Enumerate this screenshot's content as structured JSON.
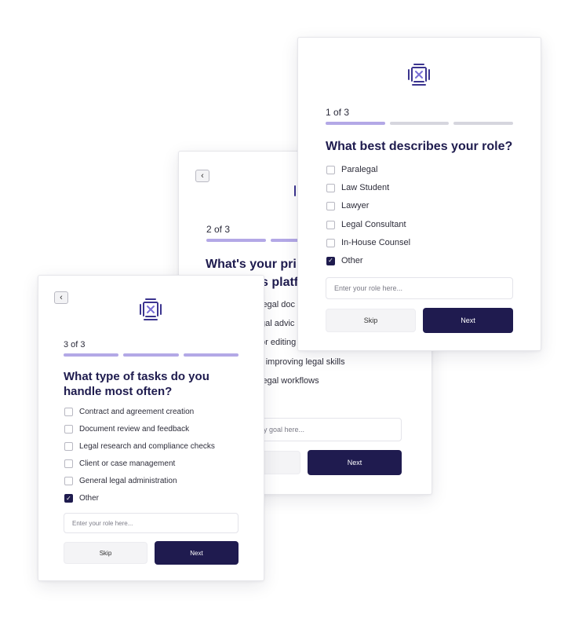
{
  "card_middle": {
    "step": "2 of 3",
    "title_line1": "What's your pri",
    "title_line2": "s platf",
    "options": [
      "legal doc",
      "gal advic",
      "or editing",
      "r improving legal skills",
      "legal workflows"
    ],
    "input_placeholder": "nary goal here...",
    "next_label": "Next"
  },
  "card_right": {
    "step": "1 of 3",
    "title": "What best describes your role?",
    "options": [
      {
        "label": "Paralegal",
        "checked": false
      },
      {
        "label": "Law Student",
        "checked": false
      },
      {
        "label": "Lawyer",
        "checked": false
      },
      {
        "label": "Legal Consultant",
        "checked": false
      },
      {
        "label": "In-House Counsel",
        "checked": false
      },
      {
        "label": "Other",
        "checked": true
      }
    ],
    "input_placeholder": "Enter your role here...",
    "skip_label": "Skip",
    "next_label": "Next"
  },
  "card_left": {
    "step": "3 of 3",
    "title_line1": "What type of tasks do you",
    "title_line2": "handle most often?",
    "options": [
      {
        "label": "Contract and agreement creation",
        "checked": false
      },
      {
        "label": "Document review and feedback",
        "checked": false
      },
      {
        "label": "Legal research and compliance checks",
        "checked": false
      },
      {
        "label": "Client or case management",
        "checked": false
      },
      {
        "label": "General legal administration",
        "checked": false
      },
      {
        "label": "Other",
        "checked": true
      }
    ],
    "input_placeholder": "Enter your role here...",
    "skip_label": "Skip",
    "next_label": "Next"
  },
  "icons": {
    "back": "chevron-left-icon",
    "logo": "brand-logo-icon",
    "check": "checkmark-icon"
  },
  "colors": {
    "primary": "#1f1b4f",
    "progress_active": "#b3a8e6",
    "progress_inactive": "#d6d6de"
  }
}
